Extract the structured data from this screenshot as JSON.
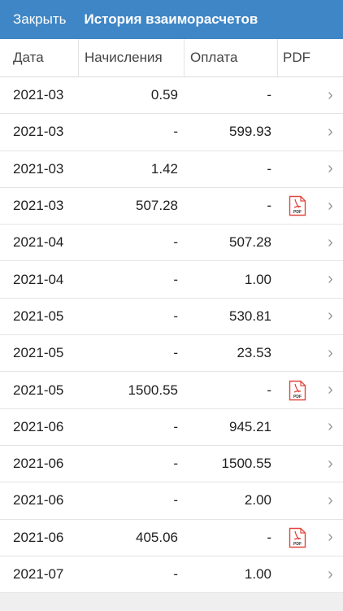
{
  "topbar": {
    "close_label": "Закрыть",
    "title": "История взаиморасчетов",
    "bg": "#3f86c6"
  },
  "table": {
    "headers": [
      "Дата",
      "Начисления",
      "Оплата",
      "PDF"
    ],
    "rows": [
      {
        "date": "2021-03",
        "charge": "0.59",
        "payment": "-",
        "has_pdf": false
      },
      {
        "date": "2021-03",
        "charge": "-",
        "payment": "599.93",
        "has_pdf": false
      },
      {
        "date": "2021-03",
        "charge": "1.42",
        "payment": "-",
        "has_pdf": false
      },
      {
        "date": "2021-03",
        "charge": "507.28",
        "payment": "-",
        "has_pdf": true
      },
      {
        "date": "2021-04",
        "charge": "-",
        "payment": "507.28",
        "has_pdf": false
      },
      {
        "date": "2021-04",
        "charge": "-",
        "payment": "1.00",
        "has_pdf": false
      },
      {
        "date": "2021-05",
        "charge": "-",
        "payment": "530.81",
        "has_pdf": false
      },
      {
        "date": "2021-05",
        "charge": "-",
        "payment": "23.53",
        "has_pdf": false
      },
      {
        "date": "2021-05",
        "charge": "1500.55",
        "payment": "-",
        "has_pdf": true
      },
      {
        "date": "2021-06",
        "charge": "-",
        "payment": "945.21",
        "has_pdf": false
      },
      {
        "date": "2021-06",
        "charge": "-",
        "payment": "1500.55",
        "has_pdf": false
      },
      {
        "date": "2021-06",
        "charge": "-",
        "payment": "2.00",
        "has_pdf": false
      },
      {
        "date": "2021-06",
        "charge": "405.06",
        "payment": "-",
        "has_pdf": true
      },
      {
        "date": "2021-07",
        "charge": "-",
        "payment": "1.00",
        "has_pdf": false
      }
    ],
    "pdf_icon_label": "PDF",
    "pdf_icon_color": "#e0473f",
    "chevron_icon": "chevron-right-icon"
  }
}
